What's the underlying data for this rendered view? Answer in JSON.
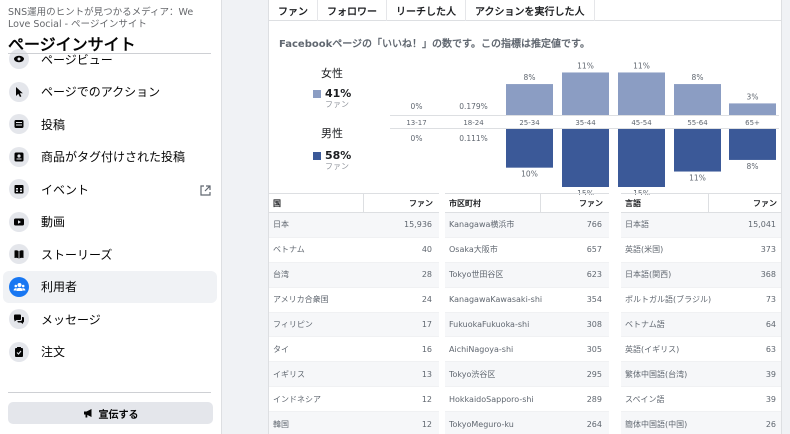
{
  "sidebar": {
    "breadcrumb": "SNS運用のヒントが見つかるメディア：We Love Social - ページインサイト",
    "title": "ページインサイト",
    "items": [
      {
        "label": "ページビュー",
        "icon": "eye-icon"
      },
      {
        "label": "ページでのアクション",
        "icon": "cursor-icon"
      },
      {
        "label": "投稿",
        "icon": "post-icon"
      },
      {
        "label": "商品がタグ付けされた投稿",
        "icon": "tagged-product-icon"
      },
      {
        "label": "イベント",
        "icon": "calendar-icon"
      },
      {
        "label": "動画",
        "icon": "video-icon"
      },
      {
        "label": "ストーリーズ",
        "icon": "book-icon"
      },
      {
        "label": "利用者",
        "icon": "people-icon"
      },
      {
        "label": "メッセージ",
        "icon": "chat-icon"
      },
      {
        "label": "注文",
        "icon": "clipboard-icon"
      }
    ],
    "promote_label": "宣伝する"
  },
  "tabs": [
    "ファン",
    "フォロワー",
    "リーチした人",
    "アクションを実行した人"
  ],
  "note": "Facebookページの「いいね！」の数です。この指標は推定値です。",
  "legend": {
    "female": {
      "heading": "女性",
      "pct": "41%",
      "sub": "ファン"
    },
    "male": {
      "heading": "男性",
      "pct": "58%",
      "sub": "ファン"
    }
  },
  "chart_data": {
    "type": "bar",
    "categories": [
      "13-17",
      "18-24",
      "25-34",
      "35-44",
      "45-54",
      "55-64",
      "65+"
    ],
    "series": [
      {
        "name": "女性",
        "values": [
          0,
          0.179,
          8,
          11,
          11,
          8,
          3
        ],
        "labels": [
          "0%",
          "0.179%",
          "8%",
          "11%",
          "11%",
          "8%",
          "3%"
        ],
        "color": "#8b9dc3"
      },
      {
        "name": "男性",
        "values": [
          0,
          0.111,
          10,
          15,
          15,
          11,
          8
        ],
        "labels": [
          "0%",
          "0.111%",
          "10%",
          "15%",
          "15%",
          "11%",
          "8%"
        ],
        "color": "#3b5998"
      }
    ]
  },
  "tables": [
    {
      "headers": [
        "国",
        "ファン"
      ],
      "rows": [
        [
          "日本",
          "15,936"
        ],
        [
          "ベトナム",
          "40"
        ],
        [
          "台湾",
          "28"
        ],
        [
          "アメリカ合衆国",
          "24"
        ],
        [
          "フィリピン",
          "17"
        ],
        [
          "タイ",
          "16"
        ],
        [
          "イギリス",
          "13"
        ],
        [
          "インドネシア",
          "12"
        ],
        [
          "韓国",
          "12"
        ]
      ]
    },
    {
      "headers": [
        "市区町村",
        "ファン"
      ],
      "rows": [
        [
          "Kanagawa横浜市",
          "766"
        ],
        [
          "Osaka大阪市",
          "657"
        ],
        [
          "Tokyo世田谷区",
          "623"
        ],
        [
          "KanagawaKawasaki-shi",
          "354"
        ],
        [
          "FukuokaFukuoka-shi",
          "308"
        ],
        [
          "AichiNagoya-shi",
          "305"
        ],
        [
          "Tokyo渋谷区",
          "295"
        ],
        [
          "HokkaidoSapporo-shi",
          "289"
        ],
        [
          "TokyoMeguro-ku",
          "264"
        ]
      ]
    },
    {
      "headers": [
        "言語",
        "ファン"
      ],
      "rows": [
        [
          "日本語",
          "15,041"
        ],
        [
          "英語(米国)",
          "373"
        ],
        [
          "日本語(関西)",
          "368"
        ],
        [
          "ポルトガル語(ブラジル)",
          "73"
        ],
        [
          "ベトナム語",
          "64"
        ],
        [
          "英語(イギリス)",
          "63"
        ],
        [
          "繁体中国語(台湾)",
          "39"
        ],
        [
          "スペイン語",
          "39"
        ],
        [
          "簡体中国語(中国)",
          "26"
        ]
      ]
    }
  ]
}
